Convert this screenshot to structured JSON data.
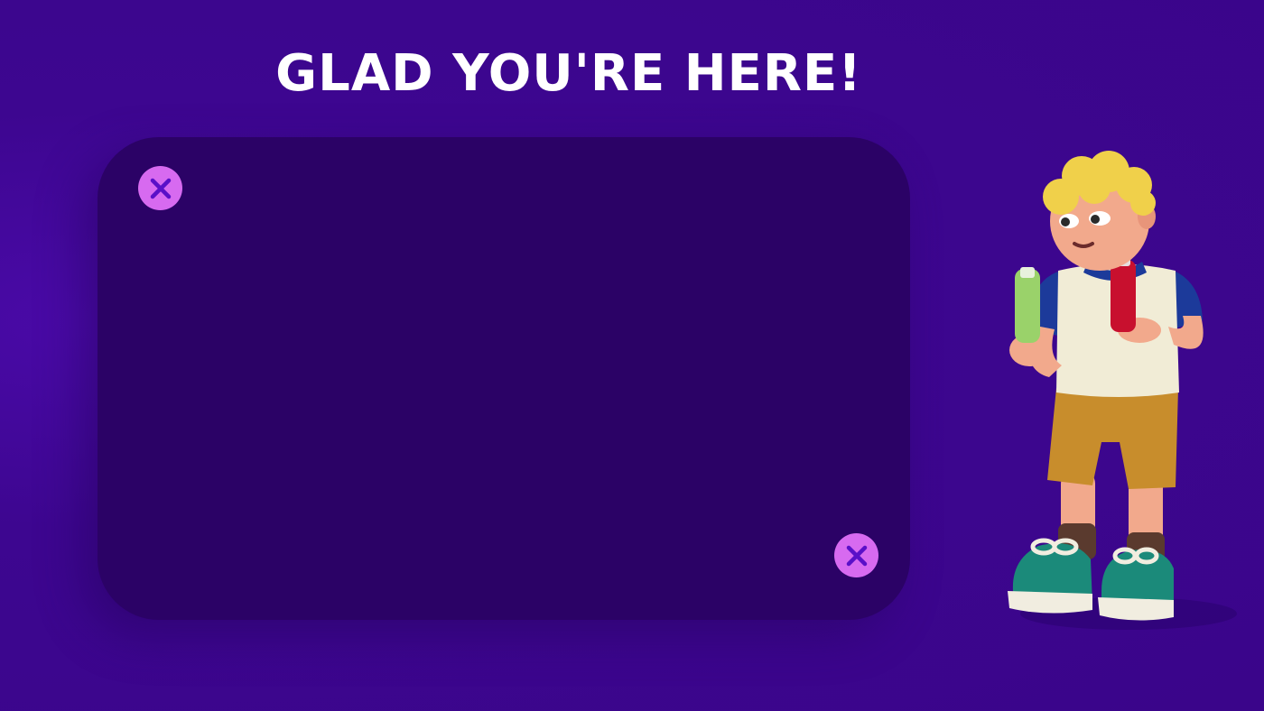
{
  "header": {
    "title": "GLAD YOU'RE HERE!"
  },
  "panel": {
    "close_buttons": [
      {
        "icon": "close-icon"
      },
      {
        "icon": "close-icon"
      }
    ]
  },
  "illustration": {
    "subject": "character-holding-bottles"
  },
  "colors": {
    "background": "#3d0690",
    "panel": "#2b0266",
    "close_button": "#d76af0",
    "close_glyph": "#5a10c8",
    "title": "#ffffff"
  }
}
